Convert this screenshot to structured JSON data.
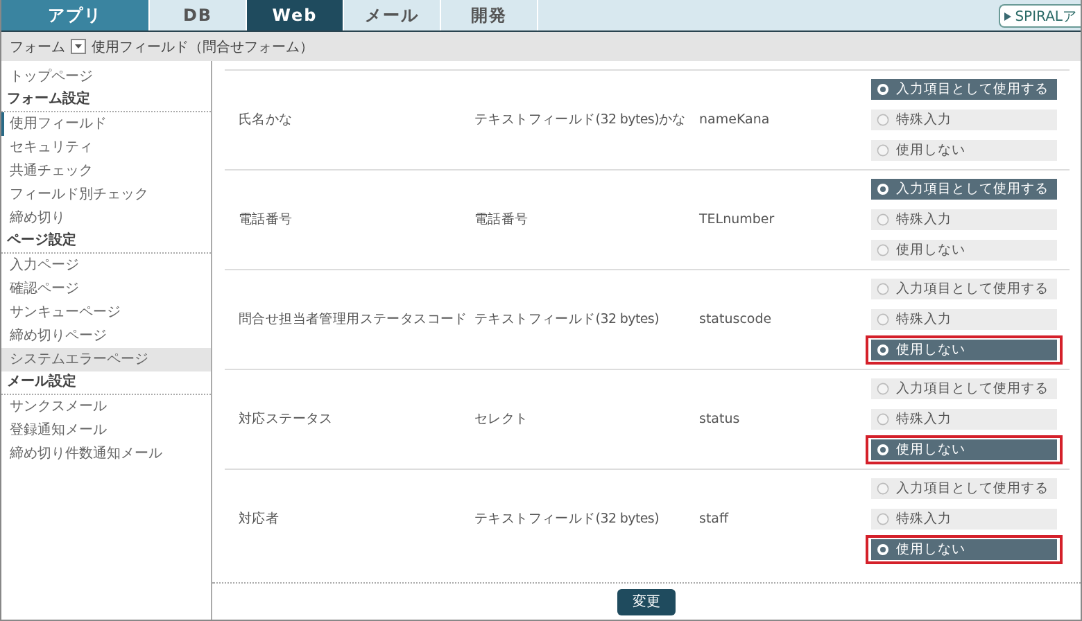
{
  "tabs": [
    {
      "label": "アプリ",
      "kind": "app",
      "selected": false
    },
    {
      "label": "DB",
      "kind": "section",
      "selected": false
    },
    {
      "label": "Web",
      "kind": "section",
      "selected": true
    },
    {
      "label": "メール",
      "kind": "section",
      "selected": false
    },
    {
      "label": "開発",
      "kind": "section",
      "selected": false
    }
  ],
  "external_button": {
    "label": "SPIRALア"
  },
  "breadcrumb": {
    "menu": "フォーム",
    "current": "使用フィールド（問合せフォーム）"
  },
  "sidebar": {
    "items": [
      {
        "label": "トップページ",
        "kind": "link",
        "selected": false,
        "hovered": false
      },
      {
        "label": "フォーム設定",
        "kind": "heading"
      },
      {
        "label": "使用フィールド",
        "kind": "link",
        "selected": true,
        "hovered": false
      },
      {
        "label": "セキュリティ",
        "kind": "link",
        "selected": false,
        "hovered": false
      },
      {
        "label": "共通チェック",
        "kind": "link",
        "selected": false,
        "hovered": false
      },
      {
        "label": "フィールド別チェック",
        "kind": "link",
        "selected": false,
        "hovered": false
      },
      {
        "label": "締め切り",
        "kind": "link",
        "selected": false,
        "hovered": false
      },
      {
        "label": "ページ設定",
        "kind": "heading"
      },
      {
        "label": "入力ページ",
        "kind": "link",
        "selected": false,
        "hovered": false
      },
      {
        "label": "確認ページ",
        "kind": "link",
        "selected": false,
        "hovered": false
      },
      {
        "label": "サンキューページ",
        "kind": "link",
        "selected": false,
        "hovered": false
      },
      {
        "label": "締め切りページ",
        "kind": "link",
        "selected": false,
        "hovered": false
      },
      {
        "label": "システムエラーページ",
        "kind": "link",
        "selected": false,
        "hovered": true
      },
      {
        "label": "メール設定",
        "kind": "heading"
      },
      {
        "label": "サンクスメール",
        "kind": "link",
        "selected": false,
        "hovered": false
      },
      {
        "label": "登録通知メール",
        "kind": "link",
        "selected": false,
        "hovered": false
      },
      {
        "label": "締め切り件数通知メール",
        "kind": "link",
        "selected": false,
        "hovered": false
      }
    ]
  },
  "fields": [
    {
      "name": "氏名かな",
      "type": "テキストフィールド(32 bytes)かな",
      "code": "nameKana",
      "options": [
        {
          "label": "入力項目として使用する",
          "selected": true,
          "highlighted": false
        },
        {
          "label": "特殊入力",
          "selected": false,
          "highlighted": false
        },
        {
          "label": "使用しない",
          "selected": false,
          "highlighted": false
        }
      ]
    },
    {
      "name": "電話番号",
      "type": "電話番号",
      "code": "TELnumber",
      "options": [
        {
          "label": "入力項目として使用する",
          "selected": true,
          "highlighted": false
        },
        {
          "label": "特殊入力",
          "selected": false,
          "highlighted": false
        },
        {
          "label": "使用しない",
          "selected": false,
          "highlighted": false
        }
      ]
    },
    {
      "name": "問合せ担当者管理用ステータスコード",
      "type": "テキストフィールド(32 bytes)",
      "code": "statuscode",
      "options": [
        {
          "label": "入力項目として使用する",
          "selected": false,
          "highlighted": false
        },
        {
          "label": "特殊入力",
          "selected": false,
          "highlighted": false
        },
        {
          "label": "使用しない",
          "selected": true,
          "highlighted": true
        }
      ]
    },
    {
      "name": "対応ステータス",
      "type": "セレクト",
      "code": "status",
      "options": [
        {
          "label": "入力項目として使用する",
          "selected": false,
          "highlighted": false
        },
        {
          "label": "特殊入力",
          "selected": false,
          "highlighted": false
        },
        {
          "label": "使用しない",
          "selected": true,
          "highlighted": true
        }
      ]
    },
    {
      "name": "対応者",
      "type": "テキストフィールド(32 bytes)",
      "code": "staff",
      "options": [
        {
          "label": "入力項目として使用する",
          "selected": false,
          "highlighted": false
        },
        {
          "label": "特殊入力",
          "selected": false,
          "highlighted": false
        },
        {
          "label": "使用しない",
          "selected": true,
          "highlighted": true
        }
      ]
    }
  ],
  "submit_button": {
    "label": "変更"
  }
}
